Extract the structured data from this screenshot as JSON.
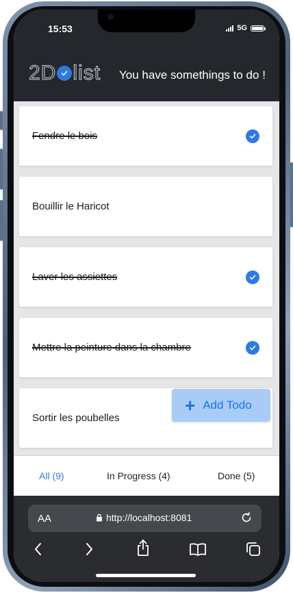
{
  "status_bar": {
    "time": "15:53",
    "network": "5G",
    "battery_level": 1.0
  },
  "header": {
    "logo_prefix": "2D",
    "logo_suffix": "list",
    "tagline": "You have somethings to do !"
  },
  "todos": [
    {
      "text": "Fendre le bois",
      "done": true
    },
    {
      "text": "Bouillir le Haricot",
      "done": false
    },
    {
      "text": "Laver les assiettes",
      "done": true
    },
    {
      "text": "Mettre la peinture dans la chambre",
      "done": true
    },
    {
      "text": "Sortir les poubelles",
      "done": false
    }
  ],
  "add_button": {
    "label": "Add Todo",
    "icon": "plus-icon"
  },
  "tabs": [
    {
      "label": "All (9)",
      "active": true
    },
    {
      "label": "In Progress (4)",
      "active": false
    },
    {
      "label": "Done (5)",
      "active": false
    }
  ],
  "browser": {
    "aa_label": "AA",
    "url": "http://localhost:8081"
  },
  "colors": {
    "accent": "#2c7be5",
    "header_bg": "#24272b",
    "add_button_bg": "#a9ccf7"
  }
}
